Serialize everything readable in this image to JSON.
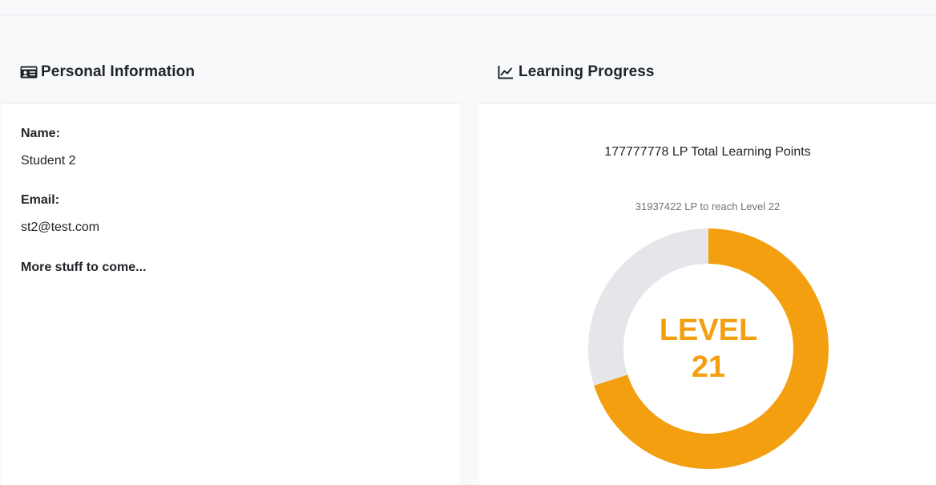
{
  "personal": {
    "title": "Personal Information",
    "icon": "id-card-icon",
    "name_label": "Name:",
    "name_value": "Student 2",
    "email_label": "Email:",
    "email_value": "st2@test.com",
    "more": "More stuff to come..."
  },
  "progress": {
    "title": "Learning Progress",
    "icon": "line-chart-icon",
    "total": "177777778 LP Total Learning Points",
    "next": "31937422 LP to reach Level 22",
    "level_word": "LEVEL",
    "level_number": "21",
    "progress_fraction": 0.7,
    "colors": {
      "filled": "#f39f10",
      "remaining": "#e5e6e9"
    }
  }
}
